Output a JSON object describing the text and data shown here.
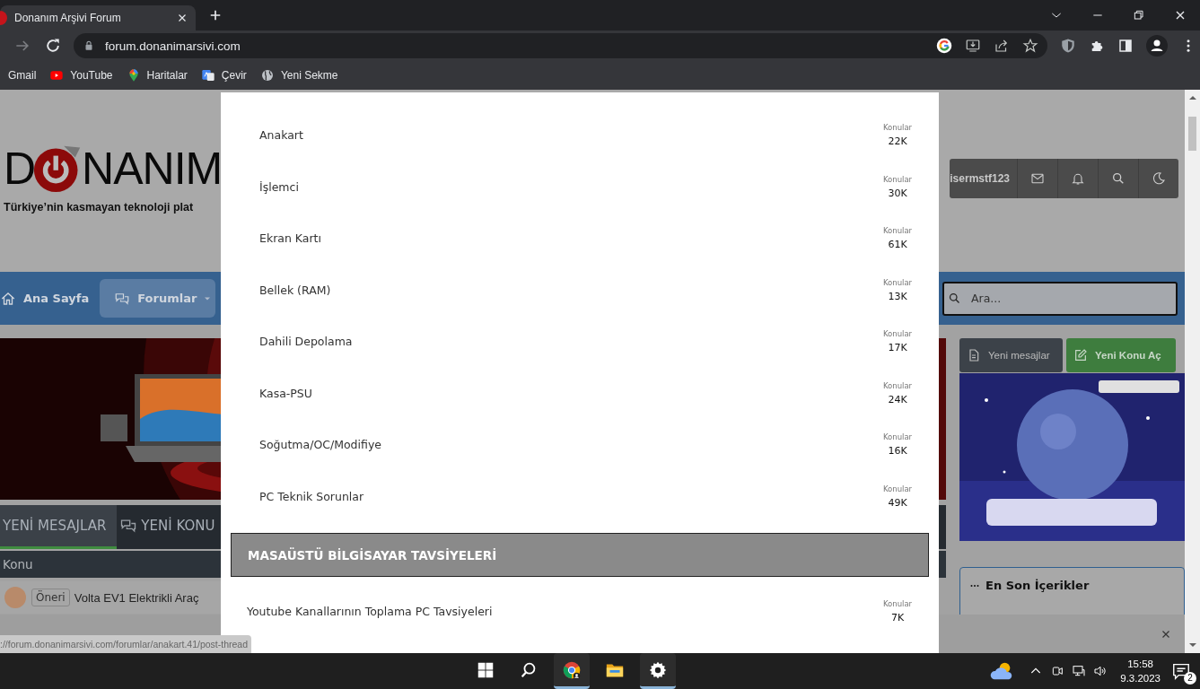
{
  "browser": {
    "tabs": [
      {
        "title": "Donanım Arşivi Forum",
        "selected": true
      }
    ],
    "address": "forum.donanimarsivi.com",
    "bookmarks": [
      {
        "label": "Gmail",
        "kind": "gmail"
      },
      {
        "label": "YouTube",
        "kind": "youtube"
      },
      {
        "label": "Haritalar",
        "kind": "maps"
      },
      {
        "label": "Çevir",
        "kind": "translate"
      },
      {
        "label": "Yeni Sekme",
        "kind": "globe"
      }
    ]
  },
  "site": {
    "logo": {
      "first": "D",
      "rest": "NANIM"
    },
    "tagline": "Türkiye’nin kasmayan teknoloji plat",
    "username": "isermstf123",
    "nav": [
      {
        "label": "Ana Sayfa",
        "kind": "home",
        "selected": false
      },
      {
        "label": "Forumlar",
        "kind": "forums",
        "selected": true
      }
    ],
    "search": {
      "placeholder": "Ara..."
    },
    "actions": [
      {
        "label": "Yeni mesajlar",
        "kind": "messages"
      },
      {
        "label": "Yeni Konu Aç",
        "kind": "new-topic"
      }
    ],
    "tabs": [
      {
        "label": "YENİ MESAJLAR",
        "selected": true
      },
      {
        "label": "YENİ KONU",
        "selected": false
      }
    ],
    "table_header": "Konu",
    "thread": {
      "tag": "Öneri",
      "title": "Volta EV1 Elektrikli Araç"
    },
    "widget": {
      "title": "En Son İçerikler"
    }
  },
  "modal": {
    "forums": [
      {
        "name": "Anakart",
        "label": "Konular",
        "count": "22K"
      },
      {
        "name": "İşlemci",
        "label": "Konular",
        "count": "30K"
      },
      {
        "name": "Ekran Kartı",
        "label": "Konular",
        "count": "61K"
      },
      {
        "name": "Bellek (RAM)",
        "label": "Konular",
        "count": "13K"
      },
      {
        "name": "Dahili Depolama",
        "label": "Konular",
        "count": "17K"
      },
      {
        "name": "Kasa-PSU",
        "label": "Konular",
        "count": "24K"
      },
      {
        "name": "Soğutma/OC/Modifiye",
        "label": "Konular",
        "count": "16K"
      },
      {
        "name": "PC Teknik Sorunlar",
        "label": "Konular",
        "count": "49K"
      }
    ],
    "section": {
      "title": "MASAÜSTÜ BİLGİSAYAR TAVSİYELERİ",
      "forums": [
        {
          "name": "Youtube Kanallarının Toplama PC Tavsiyeleri",
          "label": "Konular",
          "count": "7K"
        }
      ]
    }
  },
  "status_url": "://forum.donanimarsivi.com/forumlar/anakart.41/post-thread",
  "taskbar": {
    "apps": [
      {
        "kind": "start",
        "running": false
      },
      {
        "kind": "search",
        "running": false
      },
      {
        "kind": "chrome",
        "running": true
      },
      {
        "kind": "explorer",
        "running": false
      },
      {
        "kind": "settings",
        "running": true
      }
    ],
    "time": "15:58",
    "date": "9.3.2023",
    "notifications": "2"
  }
}
